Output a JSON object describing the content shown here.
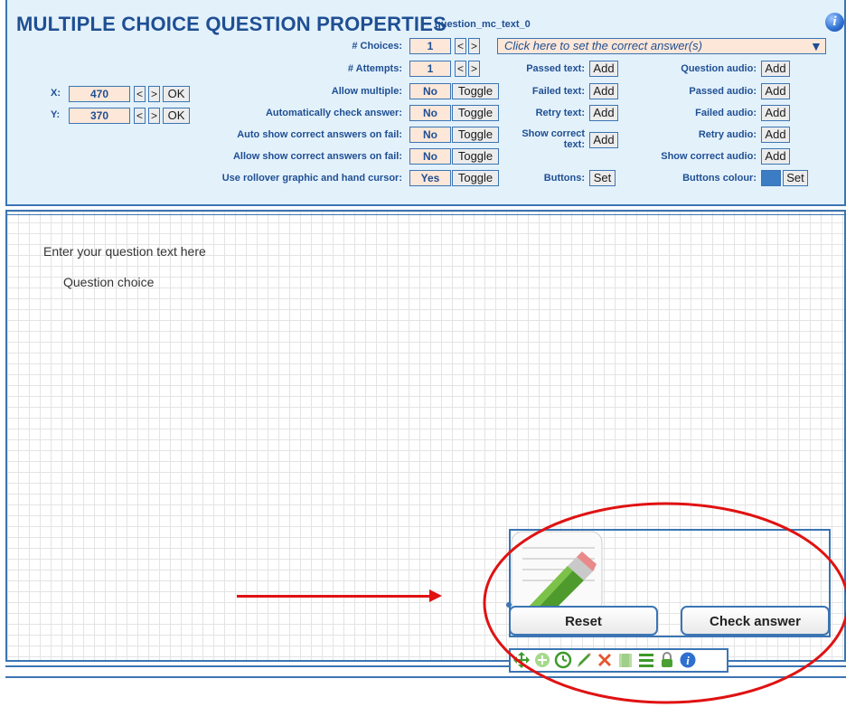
{
  "panel": {
    "title": "MULTIPLE CHOICE QUESTION PROPERTIES",
    "subtitle": "question_mc_text_0",
    "info_icon": "i"
  },
  "position": {
    "x_label": "X:",
    "x_value": "470",
    "y_label": "Y:",
    "y_value": "370",
    "ok_label": "OK",
    "dec_label": "<",
    "inc_label": ">"
  },
  "settings": {
    "choices_label": "# Choices:",
    "choices_value": "1",
    "attempts_label": "# Attempts:",
    "attempts_value": "1",
    "allow_multiple_label": "Allow multiple:",
    "allow_multiple_value": "No",
    "auto_check_label": "Automatically check answer:",
    "auto_check_value": "No",
    "auto_show_label": "Auto show correct answers on fail:",
    "auto_show_value": "No",
    "allow_show_label": "Allow show correct answers on fail:",
    "allow_show_value": "No",
    "rollover_label": "Use rollover graphic and hand cursor:",
    "rollover_value": "Yes",
    "toggle_label": "Toggle",
    "answers_placeholder": "Click here to set the correct answer(s)",
    "dropdown_arrow": "▼"
  },
  "feedback": {
    "passed_text_label": "Passed text:",
    "failed_text_label": "Failed text:",
    "retry_text_label": "Retry text:",
    "show_correct_text_label_1": "Show correct",
    "show_correct_text_label_2": "text:",
    "buttons_label": "Buttons:",
    "add_label": "Add",
    "set_label": "Set"
  },
  "audio": {
    "question_audio_label": "Question audio:",
    "passed_audio_label": "Passed audio:",
    "failed_audio_label": "Failed audio:",
    "retry_audio_label": "Retry audio:",
    "show_correct_audio_label": "Show correct audio:",
    "buttons_colour_label": "Buttons colour:",
    "buttons_colour": "#3b7cc4"
  },
  "stage": {
    "question_text": "Enter your question text here",
    "choice_text": "Question choice",
    "reset_label": "Reset",
    "check_label": "Check answer"
  },
  "toolbar": {
    "icons": [
      "move-icon",
      "add-icon",
      "timer-icon",
      "edit-icon",
      "delete-icon",
      "copy-icon",
      "list-icon",
      "lock-icon",
      "info-icon"
    ]
  },
  "annotation_color": "#e01212"
}
